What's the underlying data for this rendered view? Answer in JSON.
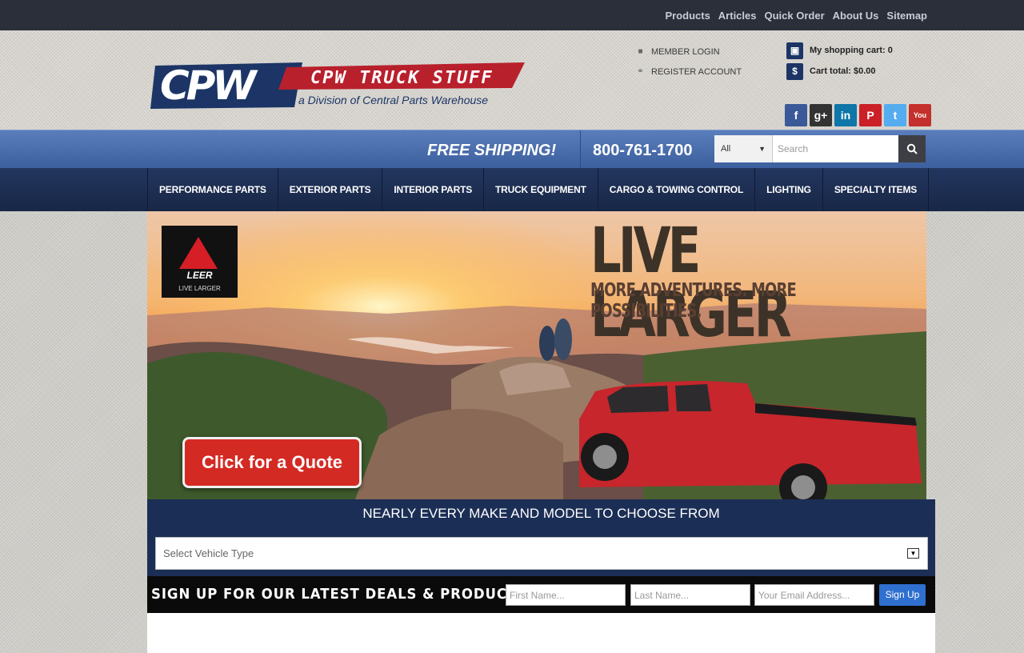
{
  "topnav": [
    "Products",
    "Articles",
    "Quick Order",
    "About Us",
    "Sitemap"
  ],
  "logo": {
    "initials": "CPW",
    "name": "CPW TRUCK STUFF",
    "tagline": "a Division of Central Parts Warehouse"
  },
  "account": {
    "login": "MEMBER LOGIN",
    "register": "REGISTER ACCOUNT"
  },
  "cart": {
    "count_label": "My shopping cart: 0",
    "total_label": "Cart total: $0.00"
  },
  "social": [
    {
      "name": "facebook-icon",
      "glyph": "f",
      "color": "#3b5998"
    },
    {
      "name": "google-plus-icon",
      "glyph": "g+",
      "color": "#333333"
    },
    {
      "name": "linkedin-icon",
      "glyph": "in",
      "color": "#0e76a8"
    },
    {
      "name": "pinterest-icon",
      "glyph": "P",
      "color": "#cb2027"
    },
    {
      "name": "twitter-icon",
      "glyph": "t",
      "color": "#55acee"
    },
    {
      "name": "youtube-icon",
      "glyph": "You",
      "color": "#c4302b"
    }
  ],
  "promo": {
    "free_shipping": "FREE SHIPPING!",
    "phone": "800-761-1700"
  },
  "search": {
    "category": "All",
    "placeholder": "Search"
  },
  "mainnav": [
    "PERFORMANCE PARTS",
    "EXTERIOR PARTS",
    "INTERIOR PARTS",
    "TRUCK EQUIPMENT",
    "CARGO & TOWING CONTROL",
    "LIGHTING",
    "SPECIALTY ITEMS"
  ],
  "hero": {
    "brand": "LEER",
    "brand_tag": "LIVE LARGER",
    "headline": "LIVE LARGER",
    "subline": "MORE ADVENTURES. MORE POSSIBILITIES.",
    "cta": "Click for a Quote"
  },
  "vehicle": {
    "heading": "NEARLY EVERY MAKE AND MODEL TO CHOOSE FROM",
    "placeholder": "Select Vehicle Type"
  },
  "signup": {
    "label": "SIGN UP FOR OUR LATEST DEALS & PRODUCTS:",
    "first_placeholder": "First Name...",
    "last_placeholder": "Last Name...",
    "email_placeholder": "Your Email Address...",
    "button": "Sign Up"
  }
}
